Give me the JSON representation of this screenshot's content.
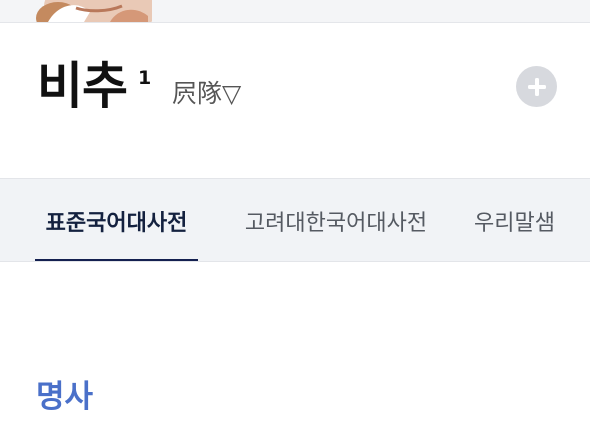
{
  "entry": {
    "headword": "비추",
    "homonym_number": "1",
    "hanja": "屄隊▽"
  },
  "actions": {
    "add_icon": "plus-icon"
  },
  "tabs": [
    {
      "label": "표준국어대사전",
      "active": true
    },
    {
      "label": "고려대한국어대사전",
      "active": false
    },
    {
      "label": "우리말샘",
      "active": false
    }
  ],
  "definition": {
    "part_of_speech": "명사"
  },
  "colors": {
    "accent": "#142050",
    "pos_blue": "#4a70c9",
    "tab_bg": "#f1f3f6",
    "add_button_bg": "#d7d9de"
  }
}
